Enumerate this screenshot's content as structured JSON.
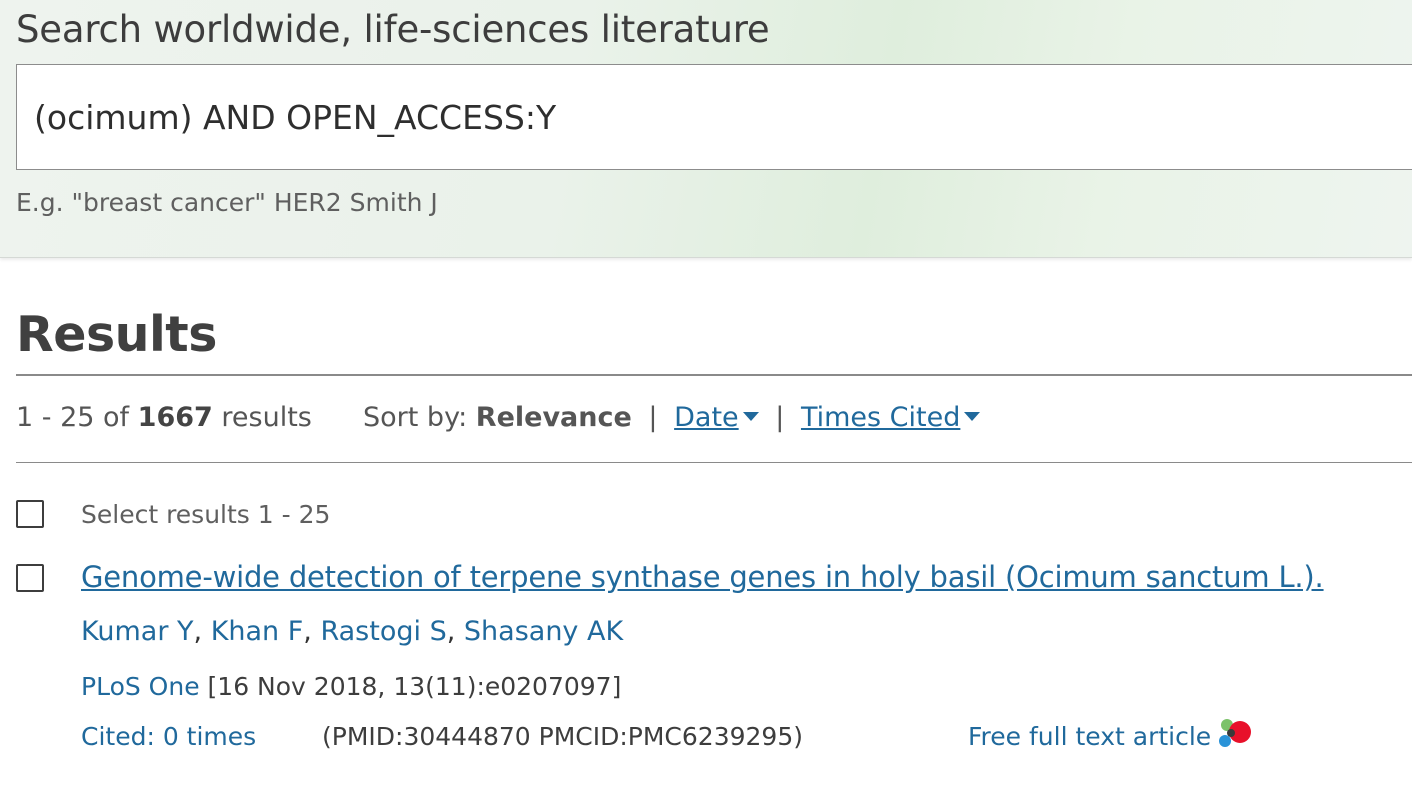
{
  "search": {
    "heading": "Search worldwide, life-sciences literature",
    "query": "(ocimum) AND OPEN_ACCESS:Y",
    "example": "E.g. \"breast cancer\" HER2 Smith J"
  },
  "results": {
    "title": "Results",
    "range": "1 - 25 of",
    "total": "1667",
    "total_suffix": "results",
    "sort_label": "Sort by:",
    "sort_current": "Relevance",
    "sort_separator": "|",
    "sort_options": [
      "Date",
      "Times Cited"
    ],
    "select_all_label": "Select results 1 - 25"
  },
  "items": [
    {
      "title": "Genome-wide detection of terpene synthase genes in holy basil (Ocimum sanctum L.).",
      "authors": [
        "Kumar Y",
        "Khan F",
        "Rastogi S",
        "Shasany AK"
      ],
      "author_separator": ",",
      "journal": "PLoS One",
      "citation": "[16 Nov 2018, 13(11):e0207097]",
      "cited": "Cited: 0 times",
      "ids": "(PMID:30444870 PMCID:PMC6239295)",
      "fulltext": "Free full text article"
    }
  ],
  "icons": {
    "sort_caret": "caret-down-icon",
    "open_access": "open-access-icon"
  },
  "colors": {
    "link": "#20699c",
    "text": "#494949"
  }
}
